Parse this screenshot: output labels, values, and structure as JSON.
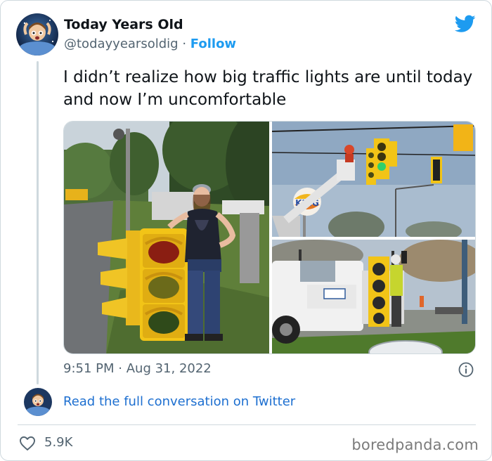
{
  "author": {
    "display_name": "Today Years Old",
    "handle": "@todayyearsoldig",
    "separator": "·",
    "follow_label": "Follow"
  },
  "tweet": {
    "text": "I didn’t realize how big traffic lights are until today and now I’m uncomfortable",
    "time": "9:51 PM",
    "date_separator": "·",
    "date": "Aug 31, 2022",
    "likes": "5.9K"
  },
  "media": {
    "sign_text": "KING"
  },
  "links": {
    "conversation": "Read the full conversation on Twitter"
  },
  "watermark": "boredpanda.com",
  "icons": {
    "brand": "twitter-bird-icon",
    "info": "info-icon",
    "like": "heart-icon"
  },
  "colors": {
    "accent": "#1d9bf0",
    "link": "#1d6fd0",
    "secondary_text": "#536471",
    "border": "#cfd9de",
    "signal_yellow": "#f2c417"
  }
}
